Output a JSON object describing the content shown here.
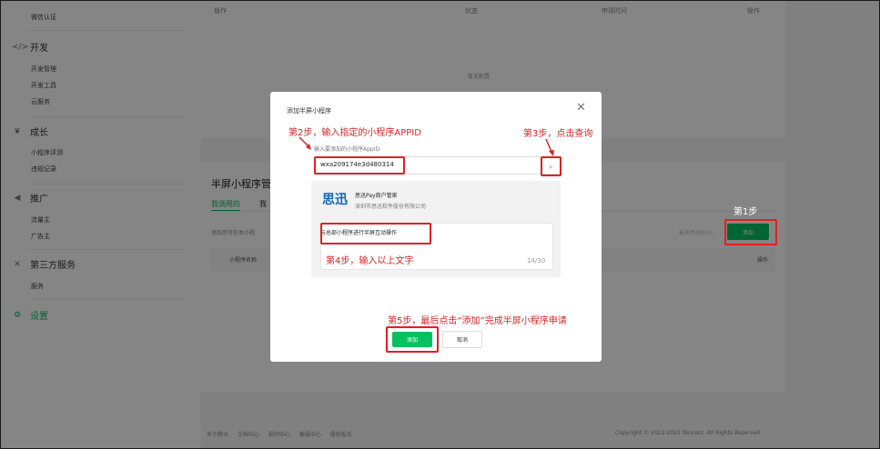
{
  "sidebar": {
    "wechat_auth": "微信认证",
    "develop": {
      "label": "开发",
      "items": [
        "开发管理",
        "开发工具",
        "云服务"
      ]
    },
    "growth": {
      "label": "成长",
      "items": [
        "小程序评测",
        "违规记录"
      ]
    },
    "promote": {
      "label": "推广",
      "items": [
        "流量主",
        "广告主"
      ]
    },
    "third_party": {
      "label": "第三方服务",
      "items": [
        "服务"
      ]
    },
    "settings": {
      "label": "设置"
    }
  },
  "top_table": {
    "headers": [
      "操作",
      "状态",
      "申请时间",
      "操作"
    ],
    "empty_text": "暂无配置"
  },
  "section": {
    "title": "半屏小程序管",
    "tabs": [
      "我调用的",
      "我"
    ],
    "hint": "添加后可在本小程",
    "hint_right": "最多添加0/10",
    "add_button": "添加",
    "table_headers": [
      "小程序名称",
      "操作"
    ]
  },
  "footer": {
    "links": [
      "关于腾讯",
      "文档中心",
      "规则中心",
      "客服中心",
      "侵权投诉"
    ],
    "copyright": "Copyright © 2012-2023 Tencent. All Rights Reserved."
  },
  "modal": {
    "title": "添加半屏小程序",
    "input_label": "输入要添加的小程序AppID",
    "input_value": "wxa209174e3d480314",
    "app_logo": "思迅",
    "app_name": "思迅Pay商户管家",
    "app_company": "深圳市思迅软件股份有限公司",
    "reason_text": "与总部小程序进行半屏互动操作",
    "char_count": "14/30",
    "add_button": "添加",
    "cancel_button": "取消"
  },
  "annotations": {
    "step1": "第1步",
    "step2": "第2步，输入指定的小程序APPID",
    "step3": "第3步，点击查询",
    "step4": "第4步，输入以上文字",
    "step5": "第5步，最后点击“添加”完成半屏小程序申请"
  },
  "colors": {
    "accent": "#07c160",
    "annotation": "#d32626",
    "overlay": "rgba(0,0,0,0.48)"
  }
}
